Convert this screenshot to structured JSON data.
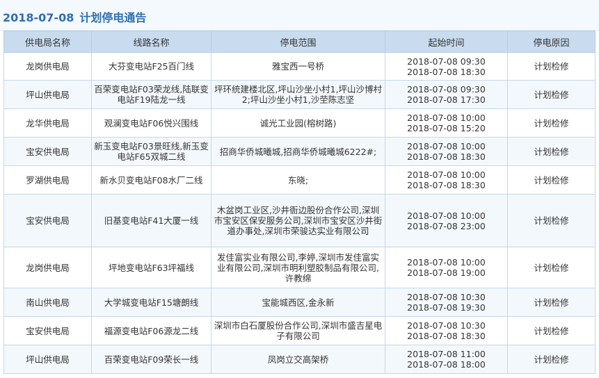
{
  "header": {
    "date": "2018-07-08",
    "title": "计划停电通告"
  },
  "table": {
    "columns": [
      "供电局名称",
      "线路名称",
      "停电范围",
      "起始时间",
      "停电原因"
    ],
    "rows": [
      {
        "bureau": "龙岗供电局",
        "line": "大芬变电站F25百门线",
        "area": "雅宝西一号桥",
        "start": "2018-07-08 09:30",
        "end": "2018-07-08 18:30",
        "reason": "计划检修"
      },
      {
        "bureau": "坪山供电局",
        "line": "百荣变电站F03荣龙线,陆联变电站F19陆龙一线",
        "area": "坪环统建楼北区,坪山沙坐小村1,坪山沙博村2;坪山沙坐小村1,沙茔陈志坚",
        "start": "2018-07-08 09:30",
        "end": "2018-07-08 17:30",
        "reason": "计划检修"
      },
      {
        "bureau": "龙华供电局",
        "line": "观澜变电站F06悦兴围线",
        "area": "诚光工业园(榕树路)",
        "start": "2018-07-08 10:00",
        "end": "2018-07-08 15:20",
        "reason": "计划检修"
      },
      {
        "bureau": "宝安供电局",
        "line": "新玉变电站F03景旺线,新玉变电站F65双城二线",
        "area": "招商华侨城曦城,招商华侨城曦城6222#;",
        "start": "2018-07-08 10:00",
        "end": "2018-07-08 18:30",
        "reason": "计划检修"
      },
      {
        "bureau": "罗湖供电局",
        "line": "新水贝变电站F08水厂二线",
        "area": "东晓;",
        "start": "2018-07-08 10:00",
        "end": "2018-07-08 18:30",
        "reason": "计划检修"
      },
      {
        "bureau": "宝安供电局",
        "line": "旧基变电站F41大厦一线",
        "area": "木盆岗工业区,沙井衙边股份合作公司,深圳市宝安区保安服务公司,深圳市宝安区沙井街道办事处,深圳市荣骏达实业有限公司",
        "start": "2018-07-08 10:00",
        "end": "2018-07-08 23:00",
        "reason": "计划检修"
      },
      {
        "bureau": "龙岗供电局",
        "line": "坪地变电站F63坪福线",
        "area": "发佳富实业有限公司,李婷,深圳市发佳富实业有限公司,深圳市明利塑胶制品有限公司,许教绵",
        "start": "2018-07-08 10:00",
        "end": "2018-07-08 19:00",
        "reason": "计划检修"
      },
      {
        "bureau": "南山供电局",
        "line": "大学城变电站F15塘朗线",
        "area": "宝能城西区,金永新",
        "start": "2018-07-08 10:30",
        "end": "2018-07-08 19:30",
        "reason": "计划检修"
      },
      {
        "bureau": "宝安供电局",
        "line": "福源变电站F06源龙二线",
        "area": "深圳市白石厦股份合作公司,深圳市盛吉星电子有限公司",
        "start": "2018-07-08 10:30",
        "end": "2018-07-08 18:30",
        "reason": "计划检修"
      },
      {
        "bureau": "坪山供电局",
        "line": "百荣变电站F09荣长一线",
        "area": "凤岗立交高架桥",
        "start": "2018-07-08 11:00",
        "end": "2018-07-08 18:00",
        "reason": "计划检修"
      }
    ]
  }
}
